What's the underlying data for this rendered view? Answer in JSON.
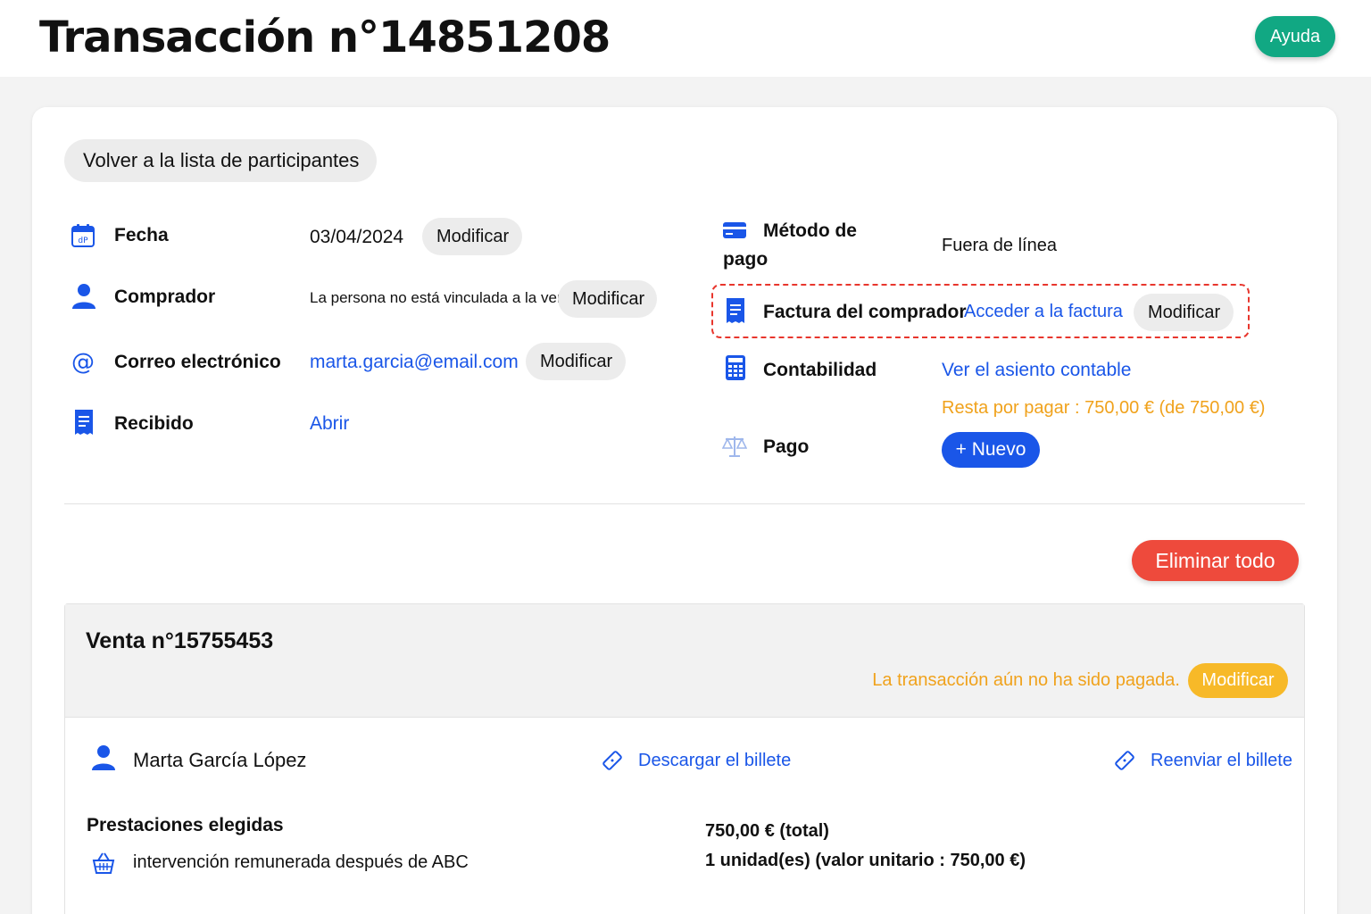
{
  "header": {
    "title": "Transacción n°14851208",
    "help_label": "Ayuda"
  },
  "back_label": "Volver a la lista de participantes",
  "left_fields": {
    "date": {
      "label": "Fecha",
      "value": "03/04/2024",
      "action": "Modificar"
    },
    "buyer": {
      "label": "Comprador",
      "value": "La persona no está vinculada a la venta",
      "action": "Modificar"
    },
    "email": {
      "label": "Correo electrónico",
      "value": "marta.garcia@email.com",
      "action": "Modificar"
    },
    "receipt": {
      "label": "Recibido",
      "link": "Abrir"
    }
  },
  "right_fields": {
    "payment_method": {
      "label_line1": "Método de",
      "label_line2": "pago",
      "value": "Fuera de línea"
    },
    "invoice": {
      "label": "Factura del comprador",
      "link": "Acceder a la factura",
      "action": "Modificar"
    },
    "accounting": {
      "label": "Contabilidad",
      "link": "Ver el asiento contable"
    },
    "remaining": "Resta por pagar : 750,00 € (de 750,00 €)",
    "payment": {
      "label": "Pago",
      "action": "+ Nuevo"
    }
  },
  "delete_all_label": "Eliminar todo",
  "sale": {
    "title": "Venta n°15755453",
    "status": "La transacción aún no ha sido pagada.",
    "status_action": "Modificar",
    "participant": "Marta García López",
    "download_ticket": "Descargar el billete",
    "resend_ticket": "Reenviar el billete",
    "services_title": "Prestaciones elegidas",
    "service_item": "intervención remunerada después de ABC",
    "total": "750,00 € (total)",
    "units": "1 unidad(es) (valor unitario : 750,00 €)"
  },
  "colors": {
    "accent_blue": "#1a56e8",
    "help_green": "#11a883",
    "danger_red": "#ee4a3c",
    "warning_orange": "#f0a21c"
  },
  "icons": {
    "date": "calendar-icon",
    "buyer": "user-icon",
    "email": "at-icon",
    "receipt": "receipt-icon",
    "payment_method": "credit-card-icon",
    "invoice": "invoice-icon",
    "accounting": "calculator-icon",
    "payment": "scale-icon",
    "ticket": "ticket-icon",
    "basket": "basket-icon"
  }
}
